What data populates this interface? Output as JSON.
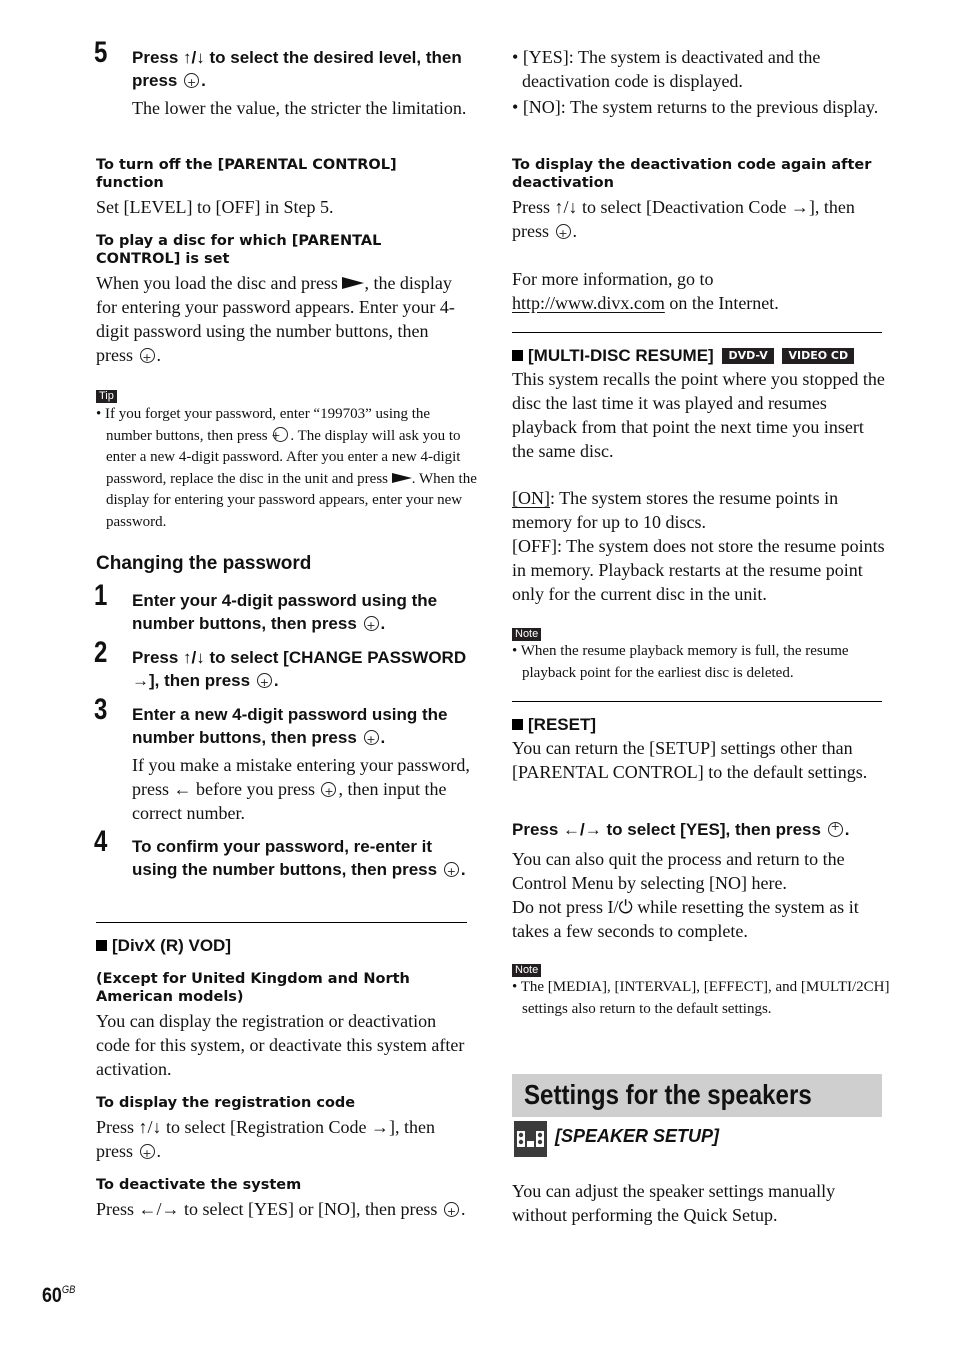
{
  "left": {
    "step5": {
      "num": "5",
      "pre": "Press ↑/↓ to select the desired level, then press",
      "post": ".",
      "note": "The lower the value, the stricter the limitation."
    },
    "turn_off": {
      "heading": "To turn off the [PARENTAL CONTROL] function",
      "body": "Set [LEVEL] to [OFF] in Step 5."
    },
    "play_disc": {
      "heading": "To play a disc for which [PARENTAL CONTROL] is set",
      "body_pre": "When you load the disc and press",
      "body_mid": ", the display for entering your password appears. Enter your 4-digit password using the number buttons, then press",
      "body_post": "."
    },
    "tip": {
      "label": "Tip",
      "pre": "If you forget your password, enter “199703” using the number buttons, then press",
      "mid": ". The display will ask you to enter a new 4-digit password. After you enter a new 4-digit password, replace the disc in the unit and press",
      "post": ". When the display for entering your password appears, enter your new password."
    },
    "changing": {
      "heading": "Changing the password",
      "steps": [
        {
          "num": "1",
          "pre": "Enter your 4-digit password using the number buttons, then press",
          "post": "."
        },
        {
          "num": "2",
          "pre": "Press ↑/↓ to select [CHANGE PASSWORD →], then press",
          "post": "."
        },
        {
          "num": "3",
          "pre": "Enter a new 4-digit password using the number buttons, then press",
          "post": "."
        },
        {
          "num": "4",
          "pre": "To confirm your password, re-enter it using the number buttons, then press",
          "post": "."
        }
      ],
      "step3_note_pre": "If you make a mistake entering your password, press ← before you press",
      "step3_note_post": ", then input the correct number."
    },
    "divx": {
      "heading": "[DivX (R) VOD]",
      "subheading": "(Except for United Kingdom and North American models)",
      "body": "You can display the registration or deactivation code for this system, or deactivate this system after activation.",
      "reg_heading": "To display the registration code",
      "reg_pre": "Press ↑/↓ to select [Registration Code →], then press",
      "reg_post": ".",
      "deact_heading": "To deactivate the system",
      "deact_pre": "Press ←/→ to select [YES] or [NO], then press",
      "deact_post": "."
    }
  },
  "right": {
    "bullets": [
      "[YES]: The system is deactivated and the deactivation code is displayed.",
      "[NO]: The system returns to the previous display."
    ],
    "deact_again": {
      "heading": "To display the deactivation code again after deactivation",
      "pre": "Press ↑/↓ to select [Deactivation Code →], then press",
      "post": "."
    },
    "more_info": {
      "pre": "For more information, go to",
      "link": "http://www.divx.com",
      "post": " on the Internet."
    },
    "multidisc": {
      "heading": "[MULTI-DISC RESUME]",
      "badges": [
        "DVD-V",
        "VIDEO CD"
      ],
      "body": "This system recalls the point where you stopped the disc the last time it was played and resumes playback from that point the next time you insert the same disc.",
      "on_label": "[ON]",
      "on_text": ": The system stores the resume points in memory for up to 10 discs.",
      "off_text": "[OFF]: The system does not store the resume points in memory. Playback restarts at the resume point only for the current disc in the unit.",
      "note_label": "Note",
      "note": "When the resume playback memory is full, the resume playback point for the earliest disc is deleted."
    },
    "reset": {
      "heading": "[RESET]",
      "body": "You can return the [SETUP] settings other than [PARENTAL CONTROL] to the default settings.",
      "instr_pre": "Press ←/→ to select [YES], then press",
      "instr_post": ".",
      "body2": "You can also quit the process and return to the Control Menu by selecting [NO] here.",
      "body3_pre": "Do not press",
      "power_glyph": "I/⏻",
      "body3_post": " while resetting the system as it takes a few seconds to complete.",
      "note_label": "Note",
      "note": "The [MEDIA], [INTERVAL], [EFFECT], and [MULTI/2CH] settings also return to the default settings."
    },
    "speakers": {
      "banner": "Settings for the speakers",
      "title": "[SPEAKER SETUP]",
      "body": "You can adjust the speaker settings manually without performing the Quick Setup."
    }
  },
  "footer": {
    "page_number": "60",
    "page_suffix": "GB"
  }
}
